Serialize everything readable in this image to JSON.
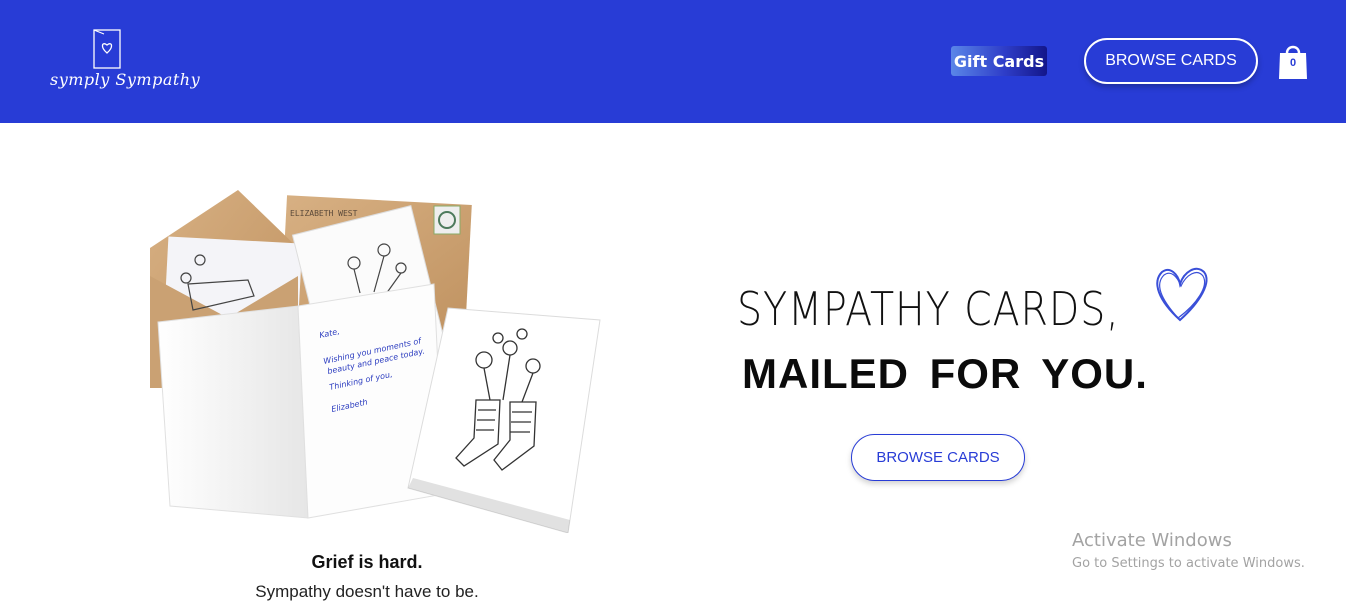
{
  "brand": {
    "logo_text": "symply Sympathy"
  },
  "header": {
    "gift_cards_label": "Gift Cards",
    "browse_label": "BROWSE CARDS",
    "cart_count": "0"
  },
  "hero": {
    "headline_line1": "SYMPATHY CARDS,",
    "headline_line2": "MAILED FOR YOU.",
    "browse_label": "BROWSE CARDS",
    "card_message": [
      "Kate,",
      "Wishing you moments of",
      "beauty and peace today.",
      "Thinking of you,",
      "Elizabeth"
    ],
    "envelope_text": "ELIZABETH WEST"
  },
  "tagline": {
    "title": "Grief is hard.",
    "subtitle": "Sympathy doesn't have to be."
  },
  "watermark": {
    "title": "Activate Windows",
    "subtitle": "Go to Settings to activate Windows."
  },
  "colors": {
    "brand_blue": "#283cd6",
    "white": "#ffffff"
  },
  "icons": [
    "card-heart-icon",
    "shopping-bag-icon",
    "heart-doodle-icon"
  ]
}
